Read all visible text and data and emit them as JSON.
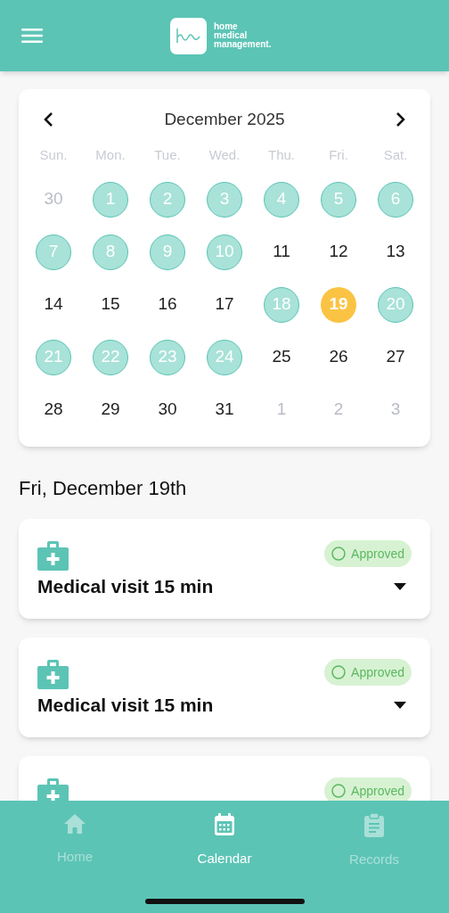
{
  "header": {
    "logo_text": [
      "home",
      "medical",
      "management."
    ]
  },
  "calendar": {
    "month": "December 2025",
    "weekdays": [
      "Sun.",
      "Mon.",
      "Tue.",
      "Wed.",
      "Thu.",
      "Fri.",
      "Sat."
    ],
    "weeks": [
      [
        {
          "day": "30",
          "kind": "other"
        },
        {
          "day": "1",
          "kind": "visit"
        },
        {
          "day": "2",
          "kind": "visit"
        },
        {
          "day": "3",
          "kind": "visit"
        },
        {
          "day": "4",
          "kind": "visit"
        },
        {
          "day": "5",
          "kind": "visit"
        },
        {
          "day": "6",
          "kind": "visit"
        }
      ],
      [
        {
          "day": "7",
          "kind": "visit"
        },
        {
          "day": "8",
          "kind": "visit"
        },
        {
          "day": "9",
          "kind": "visit"
        },
        {
          "day": "10",
          "kind": "visit"
        },
        {
          "day": "11",
          "kind": "plain"
        },
        {
          "day": "12",
          "kind": "plain"
        },
        {
          "day": "13",
          "kind": "plain"
        }
      ],
      [
        {
          "day": "14",
          "kind": "plain"
        },
        {
          "day": "15",
          "kind": "plain"
        },
        {
          "day": "16",
          "kind": "plain"
        },
        {
          "day": "17",
          "kind": "plain"
        },
        {
          "day": "18",
          "kind": "visit"
        },
        {
          "day": "19",
          "kind": "selected"
        },
        {
          "day": "20",
          "kind": "visit"
        }
      ],
      [
        {
          "day": "21",
          "kind": "visit"
        },
        {
          "day": "22",
          "kind": "visit"
        },
        {
          "day": "23",
          "kind": "visit"
        },
        {
          "day": "24",
          "kind": "visit"
        },
        {
          "day": "25",
          "kind": "plain"
        },
        {
          "day": "26",
          "kind": "plain"
        },
        {
          "day": "27",
          "kind": "plain"
        }
      ],
      [
        {
          "day": "28",
          "kind": "plain"
        },
        {
          "day": "29",
          "kind": "plain"
        },
        {
          "day": "30",
          "kind": "plain"
        },
        {
          "day": "31",
          "kind": "plain"
        },
        {
          "day": "1",
          "kind": "other"
        },
        {
          "day": "2",
          "kind": "other"
        },
        {
          "day": "3",
          "kind": "other"
        }
      ]
    ]
  },
  "date_heading": "Fri, December 19th",
  "appointments": [
    {
      "title": "Medical visit 15 min",
      "status": "Approved"
    },
    {
      "title": "Medical visit 15 min",
      "status": "Approved"
    },
    {
      "status": "Approved"
    }
  ],
  "tabs": [
    {
      "label": "Home",
      "kind": "home",
      "selected": false
    },
    {
      "label": "Calendar",
      "kind": "calendar",
      "selected": true
    },
    {
      "label": "Records",
      "kind": "records",
      "selected": false
    }
  ]
}
